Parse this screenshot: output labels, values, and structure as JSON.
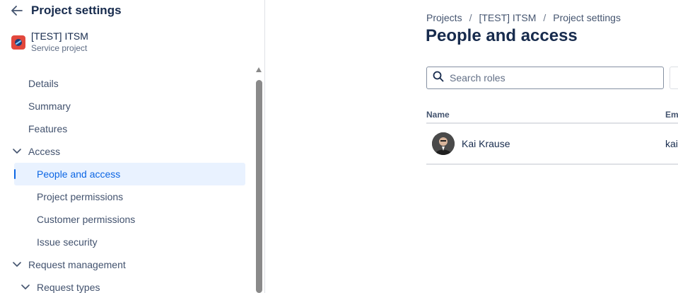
{
  "sidebar": {
    "title": "Project settings",
    "project": {
      "name": "[TEST] ITSM",
      "type": "Service project"
    },
    "items": [
      {
        "label": "Details"
      },
      {
        "label": "Summary"
      },
      {
        "label": "Features"
      },
      {
        "label": "Access"
      },
      {
        "label": "People and access"
      },
      {
        "label": "Project permissions"
      },
      {
        "label": "Customer permissions"
      },
      {
        "label": "Issue security"
      },
      {
        "label": "Request management"
      },
      {
        "label": "Request types"
      }
    ]
  },
  "breadcrumb": {
    "items": [
      "Projects",
      "[TEST] ITSM",
      "Project settings"
    ],
    "separator": "/"
  },
  "main": {
    "title": "People and access",
    "search": {
      "placeholder": "Search roles",
      "value": ""
    },
    "table": {
      "columns": [
        "Name",
        "Em"
      ],
      "rows": [
        {
          "name": "Kai Krause",
          "email": "kai"
        }
      ]
    }
  },
  "colors": {
    "accent": "#0c66e4",
    "active_bg": "#e9f2ff",
    "project_avatar": "#e2483d"
  }
}
